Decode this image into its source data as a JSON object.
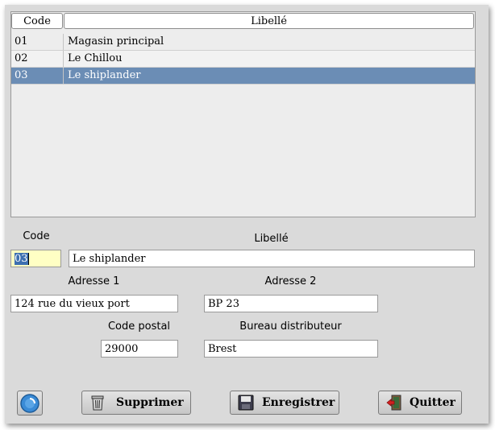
{
  "table": {
    "headers": {
      "code": "Code",
      "libelle": "Libellé"
    },
    "rows": [
      {
        "code": "01",
        "libelle": "Magasin principal"
      },
      {
        "code": "02",
        "libelle": "Le Chillou"
      },
      {
        "code": "03",
        "libelle": "Le shiplander"
      }
    ],
    "selected_index": 2
  },
  "form": {
    "code_label": "Code",
    "code_value": "03",
    "libelle_label": "Libellé",
    "libelle_value": "Le shiplander",
    "adresse1_label": "Adresse 1",
    "adresse1_value": "124 rue du vieux port",
    "adresse2_label": "Adresse 2",
    "adresse2_value": "BP 23",
    "code_postal_label": "Code postal",
    "code_postal_value": "29000",
    "bureau_label": "Bureau distributeur",
    "bureau_value": "Brest"
  },
  "buttons": {
    "help_icon": "help-icon",
    "supprimer": "Supprimer",
    "enregistrer": "Enregistrer",
    "quitter": "Quitter"
  },
  "colors": {
    "selection": "#6b8db5",
    "window_bg": "#dadada",
    "code_field_bg": "#ffffc4"
  }
}
